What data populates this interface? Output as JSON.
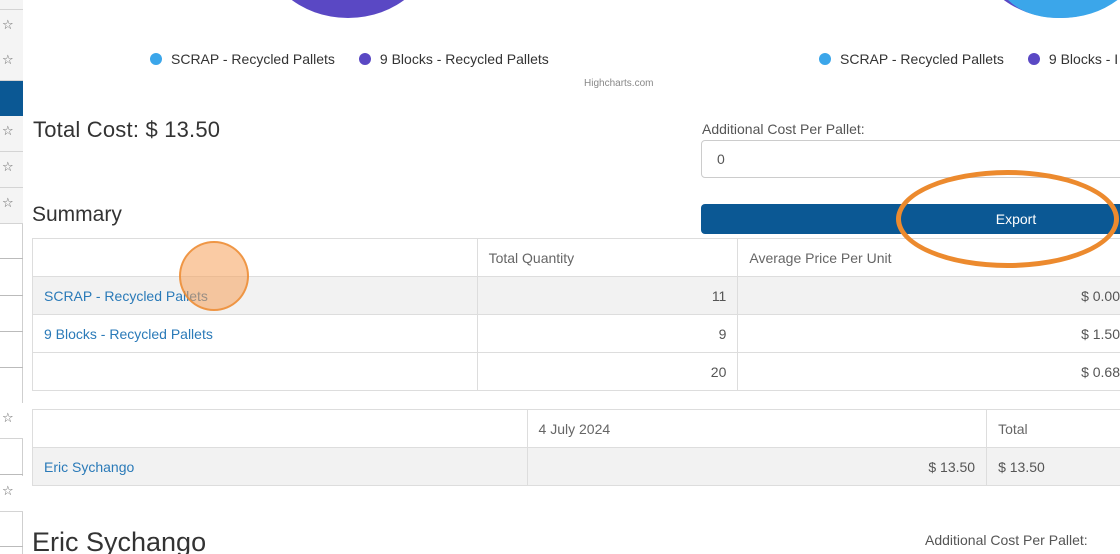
{
  "charts": {
    "credit": "Highcharts.com",
    "legend_left": [
      {
        "label": "SCRAP - Recycled Pallets",
        "color": "#3ba6ea"
      },
      {
        "label": "9 Blocks - Recycled Pallets",
        "color": "#5a48c4"
      }
    ],
    "legend_right": [
      {
        "label": "SCRAP - Recycled Pallets",
        "color": "#3ba6ea"
      },
      {
        "label": "9 Blocks - I",
        "color": "#5a48c4"
      }
    ]
  },
  "total_cost_label": "Total Cost: $ 13.50",
  "additional_cost": {
    "label": "Additional Cost Per Pallet:",
    "value": "0"
  },
  "summary": {
    "title": "Summary",
    "export_label": "Export",
    "headers": [
      "",
      "Total Quantity",
      "Average Price Per Unit"
    ],
    "rows": [
      {
        "name": "SCRAP - Recycled Pallets",
        "quantity": "11",
        "avg_price": "$ 0.00"
      },
      {
        "name": "9 Blocks - Recycled Pallets",
        "quantity": "9",
        "avg_price": "$ 1.50"
      },
      {
        "name": "",
        "quantity": "20",
        "avg_price": "$ 0.68"
      }
    ]
  },
  "person_table": {
    "headers": [
      "",
      "4 July 2024",
      "Total"
    ],
    "rows": [
      {
        "name": "Eric Sychango",
        "date_value": "$ 13.50",
        "total": "$ 13.50"
      }
    ]
  },
  "next_section": {
    "name": "Eric Sychango",
    "additional_cost_label": "Additional Cost Per Pallet:"
  },
  "sidebar": {
    "icon": "star-icon",
    "accent": "#0b5894"
  },
  "annotations": {
    "highlight_color": "#ec8a2e"
  }
}
